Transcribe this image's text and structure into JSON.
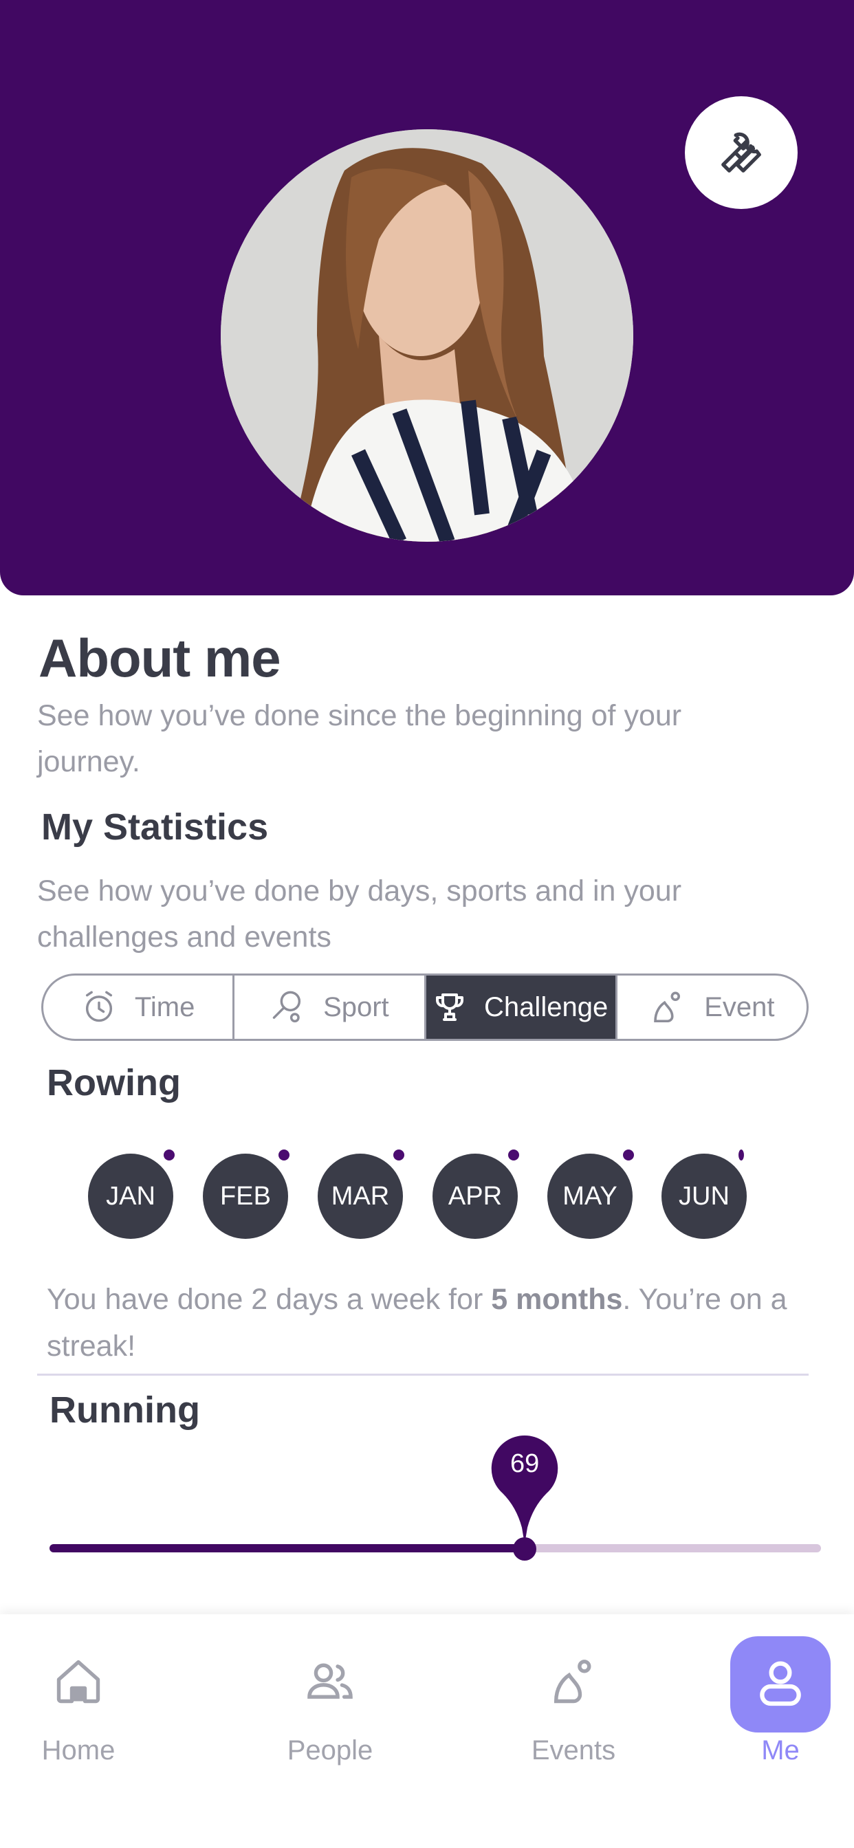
{
  "profile": {
    "settings_icon": "wrench-icon",
    "avatar_alt": "profile photo"
  },
  "about": {
    "title": "About me",
    "subtitle": "See how you’ve done since the beginning of your journey."
  },
  "statistics": {
    "title": "My Statistics",
    "subtitle": "See how you’ve done by days, sports and in your challenges and events",
    "tabs": [
      {
        "label": "Time",
        "icon": "alarm-clock-icon"
      },
      {
        "label": "Sport",
        "icon": "racket-icon"
      },
      {
        "label": "Challenge",
        "icon": "trophy-icon",
        "active": true
      },
      {
        "label": "Event",
        "icon": "event-pin-icon"
      }
    ]
  },
  "rowing": {
    "title": "Rowing",
    "months": [
      "JAN",
      "FEB",
      "MAR",
      "APR",
      "MAY",
      "JUN"
    ],
    "streak_prefix": "You have done 2 days a week for ",
    "streak_bold": "5 months",
    "streak_suffix": ". You’re on a streak!"
  },
  "running": {
    "title": "Running",
    "slider_value": "69",
    "slider_fraction": 0.616
  },
  "nav": {
    "items": [
      {
        "label": "Home",
        "icon": "home-icon"
      },
      {
        "label": "People",
        "icon": "people-icon"
      },
      {
        "label": "Events",
        "icon": "events-icon"
      },
      {
        "label": "Me",
        "icon": "user-icon",
        "active": true
      }
    ]
  },
  "colors": {
    "header_bg": "#410862",
    "accent": "#8f88f7",
    "dark": "#3a3c48",
    "muted_text": "#9a9ba5"
  }
}
